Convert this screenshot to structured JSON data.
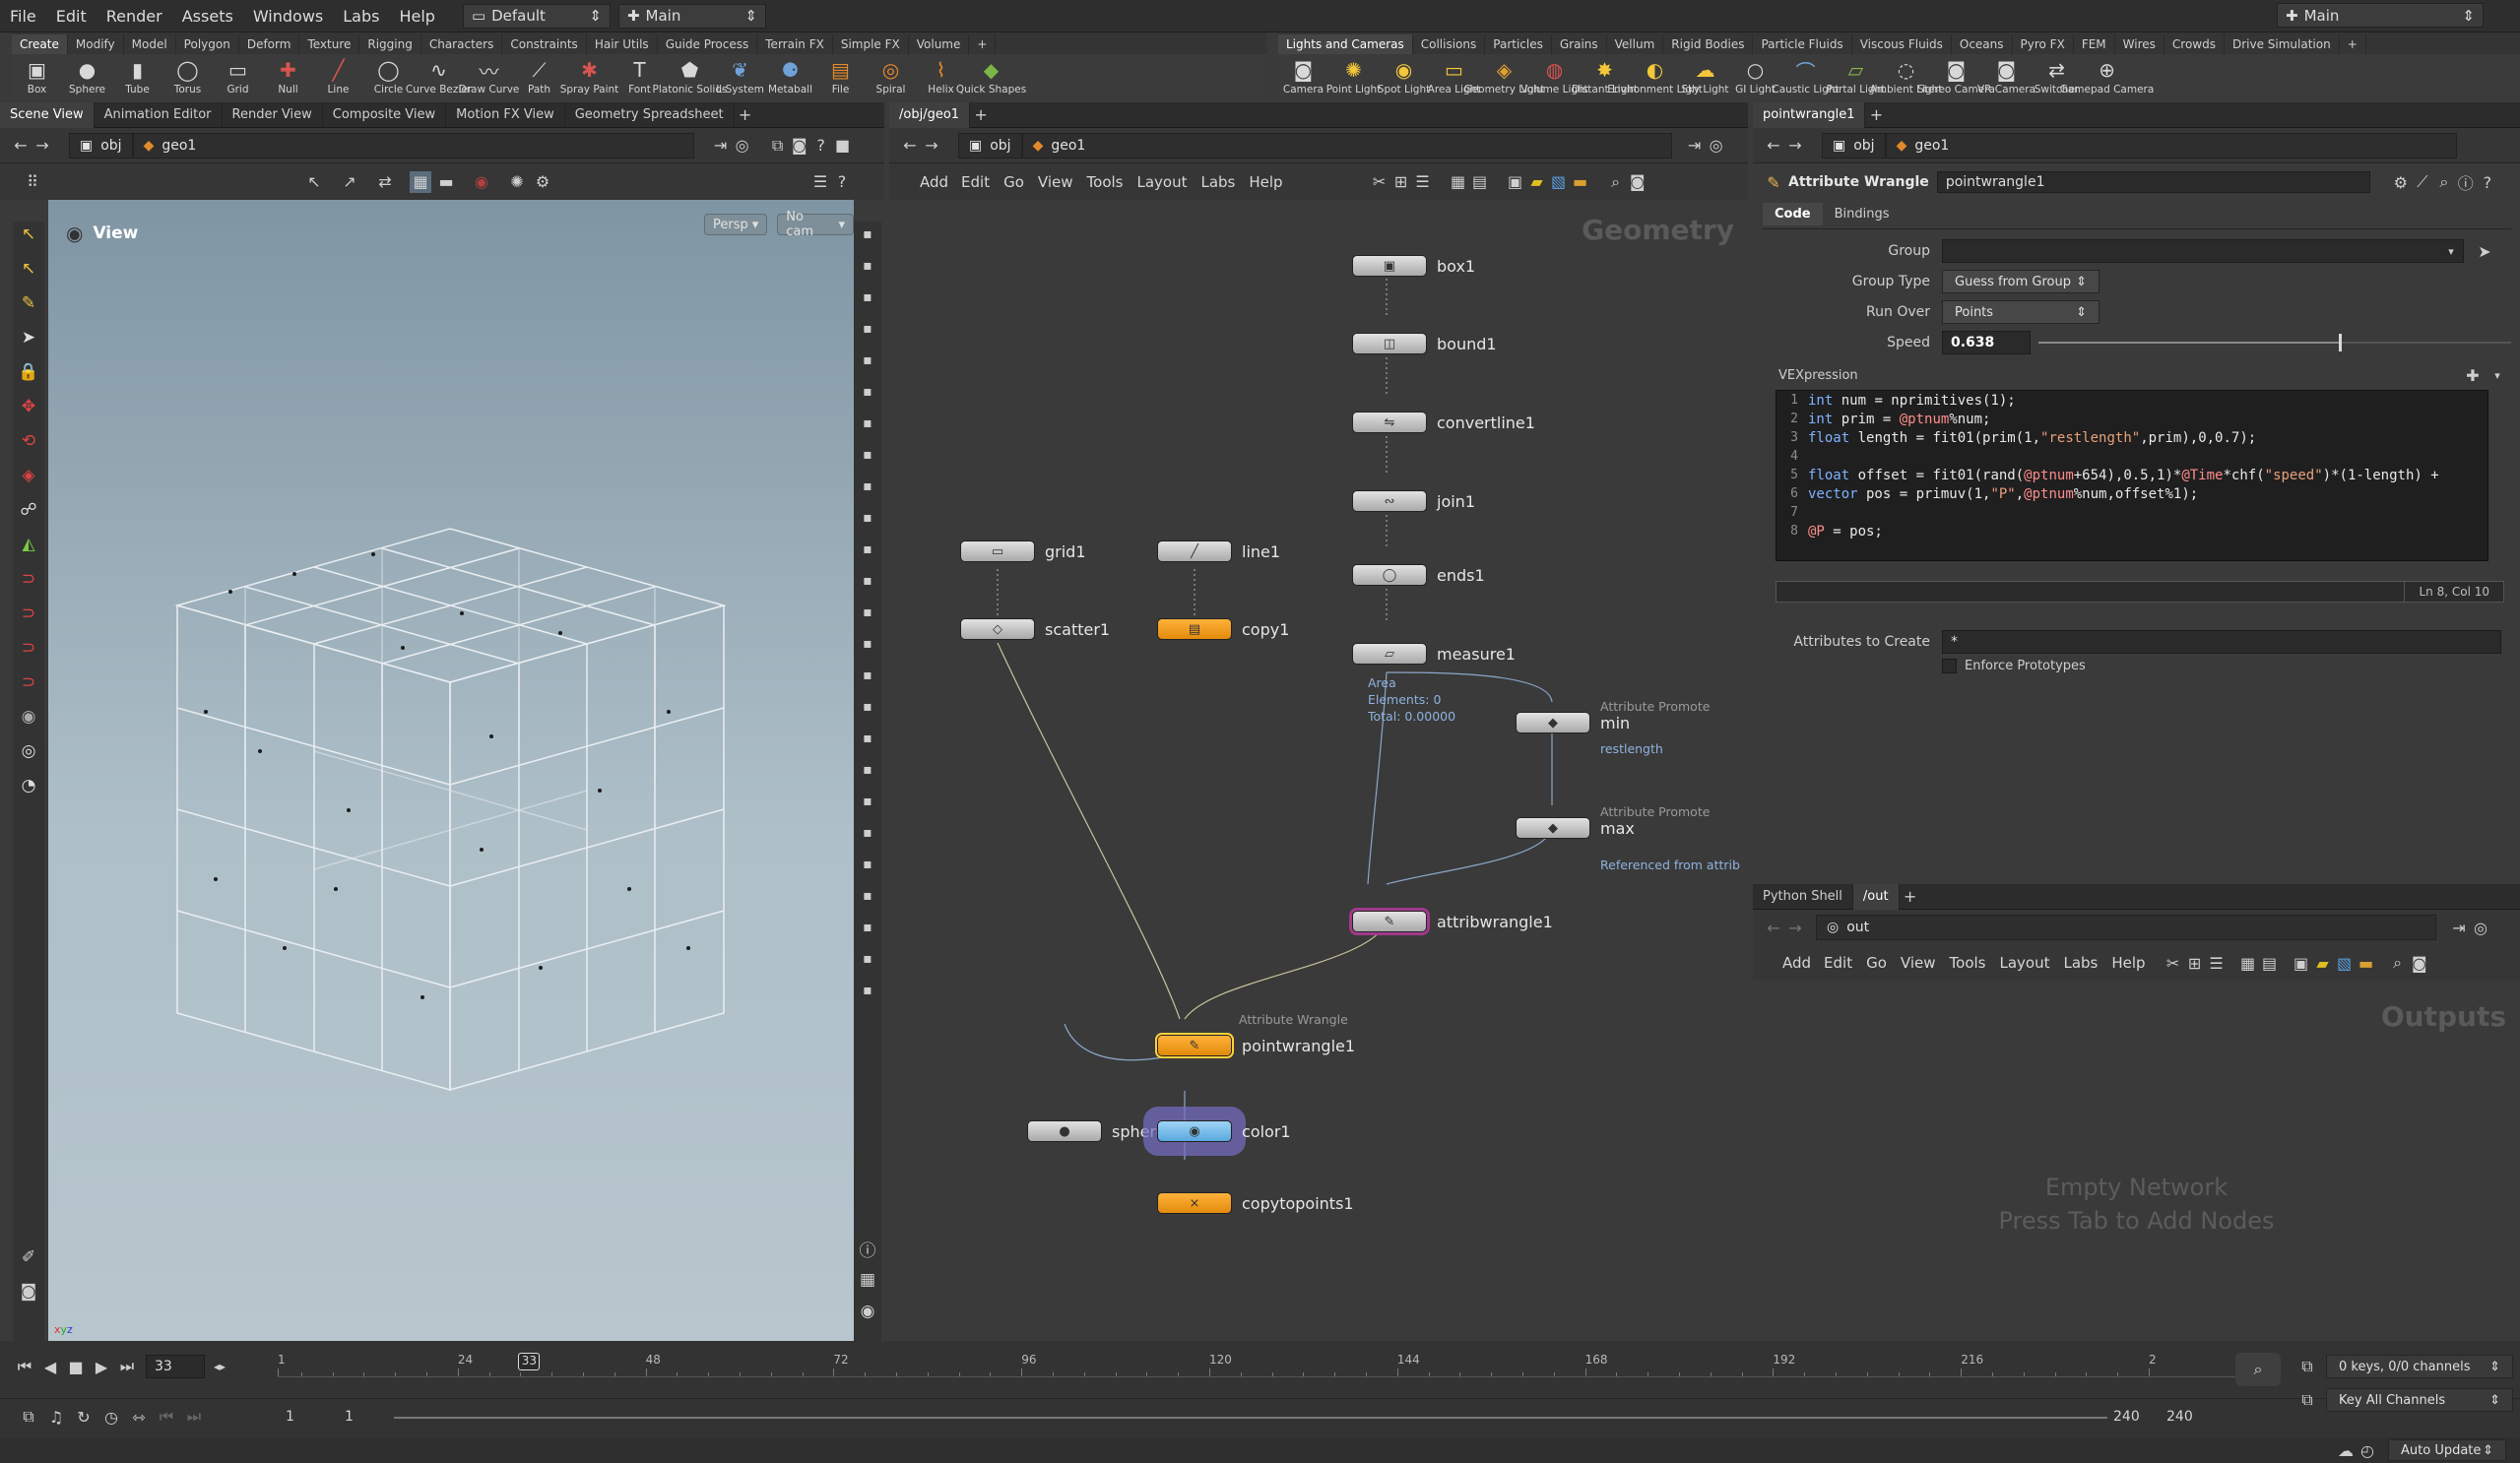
{
  "menubar": {
    "items": [
      "File",
      "Edit",
      "Render",
      "Assets",
      "Windows",
      "Labs",
      "Help"
    ],
    "desktop": "Default",
    "context": "Main",
    "right_context": "Main"
  },
  "shelf_tabs_left": [
    "Create",
    "Modify",
    "Model",
    "Polygon",
    "Deform",
    "Texture",
    "Rigging",
    "Characters",
    "Constraints",
    "Hair Utils",
    "Guide Process",
    "Terrain FX",
    "Simple FX",
    "Volume"
  ],
  "shelf_tabs_right": [
    "Lights and Cameras",
    "Collisions",
    "Particles",
    "Grains",
    "Vellum",
    "Rigid Bodies",
    "Particle Fluids",
    "Viscous Fluids",
    "Oceans",
    "Pyro FX",
    "FEM",
    "Wires",
    "Crowds",
    "Drive Simulation"
  ],
  "shelf_tools_left": [
    {
      "label": "Box",
      "icon": "box-icon"
    },
    {
      "label": "Sphere",
      "icon": "sphere-icon"
    },
    {
      "label": "Tube",
      "icon": "tube-icon"
    },
    {
      "label": "Torus",
      "icon": "torus-icon"
    },
    {
      "label": "Grid",
      "icon": "grid-icon"
    },
    {
      "label": "Null",
      "icon": "null-icon"
    },
    {
      "label": "Line",
      "icon": "line-icon"
    },
    {
      "label": "Circle",
      "icon": "circle-icon"
    },
    {
      "label": "Curve Bezier",
      "icon": "curve-bezier-icon"
    },
    {
      "label": "Draw Curve",
      "icon": "draw-curve-icon"
    },
    {
      "label": "Path",
      "icon": "path-icon"
    },
    {
      "label": "Spray Paint",
      "icon": "spray-paint-icon"
    },
    {
      "label": "Font",
      "icon": "font-icon"
    },
    {
      "label": "Platonic Solids",
      "icon": "platonic-icon"
    },
    {
      "label": "L-System",
      "icon": "lsystem-icon"
    },
    {
      "label": "Metaball",
      "icon": "metaball-icon"
    },
    {
      "label": "File",
      "icon": "file-icon"
    },
    {
      "label": "Spiral",
      "icon": "spiral-icon"
    },
    {
      "label": "Helix",
      "icon": "helix-icon"
    },
    {
      "label": "Quick Shapes",
      "icon": "quick-shapes-icon"
    }
  ],
  "shelf_tools_right": [
    {
      "label": "Camera",
      "icon": "camera-icon"
    },
    {
      "label": "Point Light",
      "icon": "point-light-icon"
    },
    {
      "label": "Spot Light",
      "icon": "spot-light-icon"
    },
    {
      "label": "Area Light",
      "icon": "area-light-icon"
    },
    {
      "label": "Geometry Light",
      "icon": "geometry-light-icon"
    },
    {
      "label": "Volume Light",
      "icon": "volume-light-icon"
    },
    {
      "label": "Distant Light",
      "icon": "distant-light-icon"
    },
    {
      "label": "Environment Light",
      "icon": "environment-light-icon"
    },
    {
      "label": "Sky Light",
      "icon": "sky-light-icon"
    },
    {
      "label": "GI Light",
      "icon": "gi-light-icon"
    },
    {
      "label": "Caustic Light",
      "icon": "caustic-light-icon"
    },
    {
      "label": "Portal Light",
      "icon": "portal-light-icon"
    },
    {
      "label": "Ambient Light",
      "icon": "ambient-light-icon"
    },
    {
      "label": "Stereo Camera",
      "icon": "stereo-camera-icon"
    },
    {
      "label": "VR Camera",
      "icon": "vr-camera-icon"
    },
    {
      "label": "Switcher",
      "icon": "switcher-icon"
    },
    {
      "label": "Gamepad Camera",
      "icon": "gamepad-camera-icon"
    }
  ],
  "left_pane": {
    "tabs": [
      "Scene View",
      "Animation Editor",
      "Render View",
      "Composite View",
      "Motion FX View",
      "Geometry Spreadsheet"
    ],
    "path_obj": "obj",
    "path_geo": "geo1",
    "view_label": "View",
    "persp": "Persp",
    "cam": "No cam"
  },
  "mid_pane": {
    "tab": "/obj/geo1",
    "path_obj": "obj",
    "path_geo": "geo1",
    "menu": [
      "Add",
      "Edit",
      "Go",
      "View",
      "Tools",
      "Layout",
      "Labs",
      "Help"
    ],
    "context_label": "Geometry"
  },
  "nodes": {
    "box1": "box1",
    "bound1": "bound1",
    "convertline1": "convertline1",
    "join1": "join1",
    "ends1": "ends1",
    "measure1": "measure1",
    "grid1": "grid1",
    "scatter1": "scatter1",
    "line1": "line1",
    "copy1": "copy1",
    "min": "min",
    "max": "max",
    "min_type": "Attribute Promote",
    "max_type": "Attribute Promote",
    "min_info": "restlength",
    "max_info": "Referenced from attrib",
    "measure_info": [
      "Area",
      "Elements: 0",
      "Total: 0.00000"
    ],
    "attribwrangle1": "attribwrangle1",
    "pointwrangle1": "pointwrangle1",
    "pointwrangle_type": "Attribute Wrangle",
    "sphere": "sphere",
    "color1": "color1",
    "copytopoints1": "copytopoints1"
  },
  "right_pane": {
    "tab": "pointwrangle1",
    "path_obj": "obj",
    "path_geo": "geo1",
    "node_type": "Attribute Wrangle",
    "node_name": "pointwrangle1",
    "param_tabs": [
      "Code",
      "Bindings"
    ],
    "group_label": "Group",
    "group_value": "",
    "group_type_label": "Group Type",
    "group_type_value": "Guess from Group",
    "run_over_label": "Run Over",
    "run_over_value": "Points",
    "speed_label": "Speed",
    "speed_value": "0.638",
    "speed_fraction": 0.638,
    "vex_label": "VEXpression",
    "code_lines": [
      "int num = nprimitives(1);",
      "int prim = @ptnum%num;",
      "float length = fit01(prim(1,\"restlength\",prim),0,0.7);",
      "",
      "float offset = fit01(rand(@ptnum+654),0.5,1)*@Time*chf(\"speed\")*(1-length) +",
      "vector pos = primuv(1,\"P\",@ptnum%num,offset%1);",
      "",
      "@P = pos;"
    ],
    "cursor_pos": "Ln 8, Col 10",
    "attrs_label": "Attributes to Create",
    "attrs_value": "*",
    "enforce_label": "Enforce Prototypes"
  },
  "bottom_right_pane": {
    "tabs": [
      "Python Shell",
      "/out"
    ],
    "path": "out",
    "menu": [
      "Add",
      "Edit",
      "Go",
      "View",
      "Tools",
      "Layout",
      "Labs",
      "Help"
    ],
    "context_label": "Outputs",
    "empty_line1": "Empty Network",
    "empty_line2": "Press Tab to Add Nodes"
  },
  "timeline": {
    "current_frame": "33",
    "start": "1",
    "start2": "1",
    "end": "240",
    "end2": "240",
    "ticks": [
      "1",
      "24",
      "48",
      "72",
      "96",
      "120",
      "144",
      "168",
      "192",
      "216",
      "2"
    ],
    "keys_info": "0 keys, 0/0 channels",
    "key_all": "Key All Channels",
    "auto_update": "Auto Update",
    "marker": "33"
  }
}
